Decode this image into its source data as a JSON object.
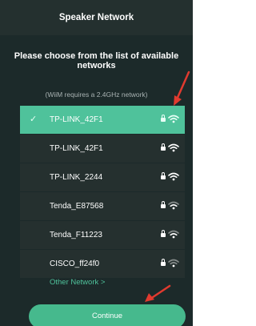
{
  "header": {
    "title": "Speaker Network"
  },
  "prompt": "Please choose from the list of available networks",
  "note": "(WiiM requires a 2.4GHz network)",
  "networks": [
    {
      "ssid": "TP-LINK_42F1",
      "selected": true
    },
    {
      "ssid": "TP-LINK_42F1",
      "selected": false
    },
    {
      "ssid": "TP-LINK_2244",
      "selected": false
    },
    {
      "ssid": "Tenda_E87568",
      "selected": false
    },
    {
      "ssid": "Tenda_F11223",
      "selected": false
    },
    {
      "ssid": "CISCO_ff24f0",
      "selected": false
    }
  ],
  "other_network": "Other Network >",
  "continue_label": "Continue",
  "icons": {
    "check": "check-icon",
    "lock": "lock-icon",
    "wifi": "wifi-icon"
  },
  "colors": {
    "background": "#1c2a2a",
    "row": "#25302f",
    "selected_row": "#4fc29b",
    "accent": "#46b98d",
    "annotation_arrow": "#e03a2f"
  }
}
